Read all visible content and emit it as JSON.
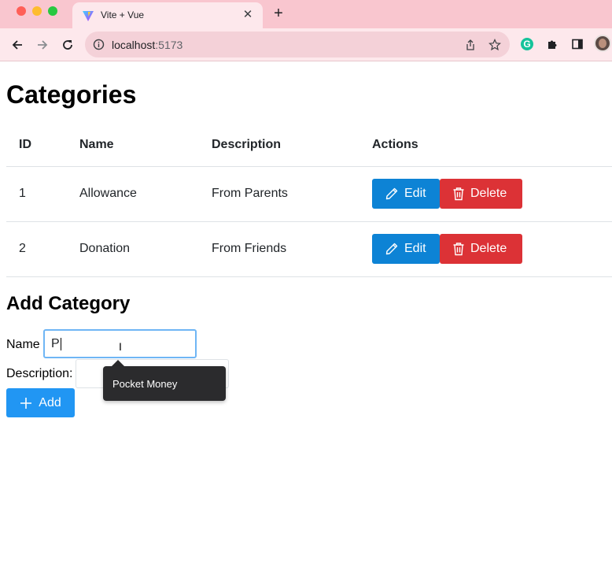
{
  "browser": {
    "tab_title": "Vite + Vue",
    "url_host": "localhost",
    "url_port": ":5173"
  },
  "page": {
    "title": "Categories",
    "table": {
      "headers": [
        "ID",
        "Name",
        "Description",
        "Actions"
      ],
      "rows": [
        {
          "id": "1",
          "name": "Allowance",
          "description": "From Parents"
        },
        {
          "id": "2",
          "name": "Donation",
          "description": "From Friends"
        }
      ],
      "edit_label": "Edit",
      "delete_label": "Delete"
    },
    "form": {
      "heading": "Add Category",
      "name_label": "Name",
      "name_value": "P",
      "description_label": "Description:",
      "description_value": "",
      "add_label": "Add",
      "autocomplete_suggestion": "Pocket Money"
    }
  },
  "colors": {
    "edit": "#0d83d5",
    "delete": "#dc3236",
    "add": "#2196f3"
  }
}
